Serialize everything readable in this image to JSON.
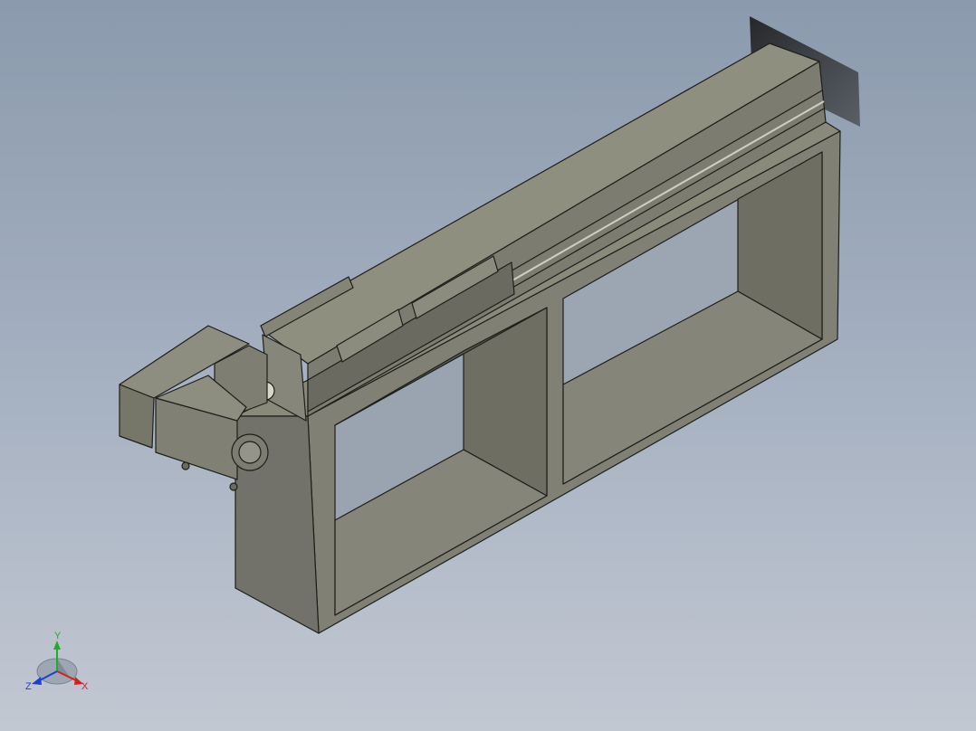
{
  "viewport": {
    "background_top": "#8b9aad",
    "background_bottom": "#c2c8d2",
    "model_face_color": "#7a7a6c",
    "model_edge_color": "#1e1e1a"
  },
  "triad": {
    "x_label": "X",
    "y_label": "Y",
    "z_label": "Z",
    "x_color": "#d42020",
    "y_color": "#1fae2a",
    "z_color": "#1f3fd4"
  }
}
